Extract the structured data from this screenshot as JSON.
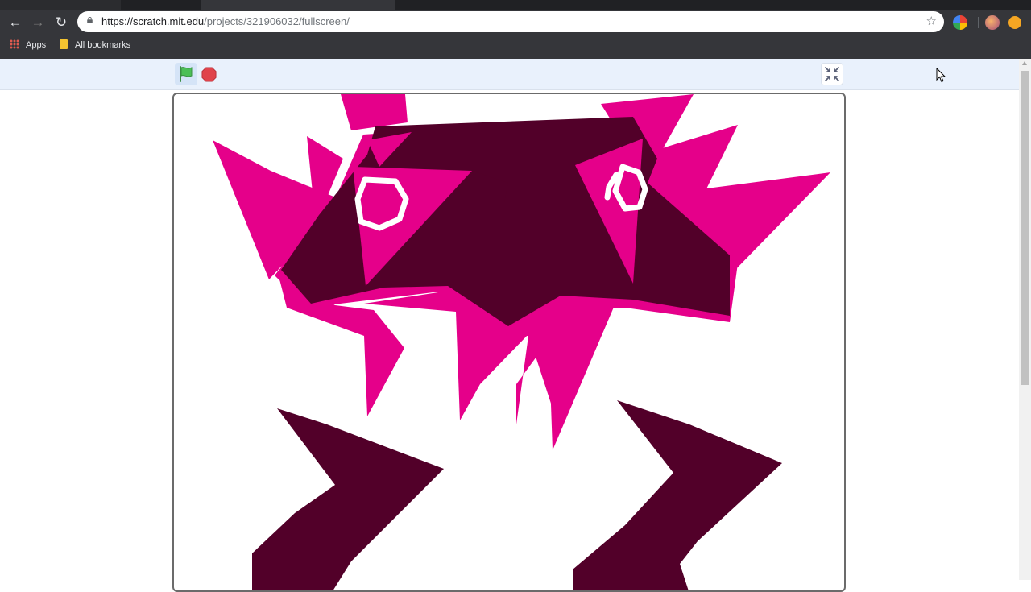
{
  "browser": {
    "url_host": "https://scratch.mit.edu",
    "url_path": "/projects/321906032/fullscreen/",
    "bookmarks": [
      {
        "label": "Apps",
        "icon": "apps-grid-icon"
      },
      {
        "label": "All bookmarks",
        "icon": "bookmark-folder-icon"
      }
    ],
    "icons": {
      "back": "arrow-left-icon",
      "forward": "arrow-right-icon",
      "reload": "reload-icon",
      "secure": "lock-icon",
      "bookmark_star": "star-icon"
    }
  },
  "scratch_player": {
    "green_flag": "green-flag-icon",
    "stop": "stop-sign-icon",
    "exit_fullscreen": "exit-fullscreen-icon"
  },
  "colors": {
    "pink": "#e5008a",
    "maroon": "#520029",
    "chrome_dark": "#35363a",
    "controls_bg": "#e9f1fc",
    "stop_red": "#e0434b",
    "flag_green": "#4cbf56"
  }
}
